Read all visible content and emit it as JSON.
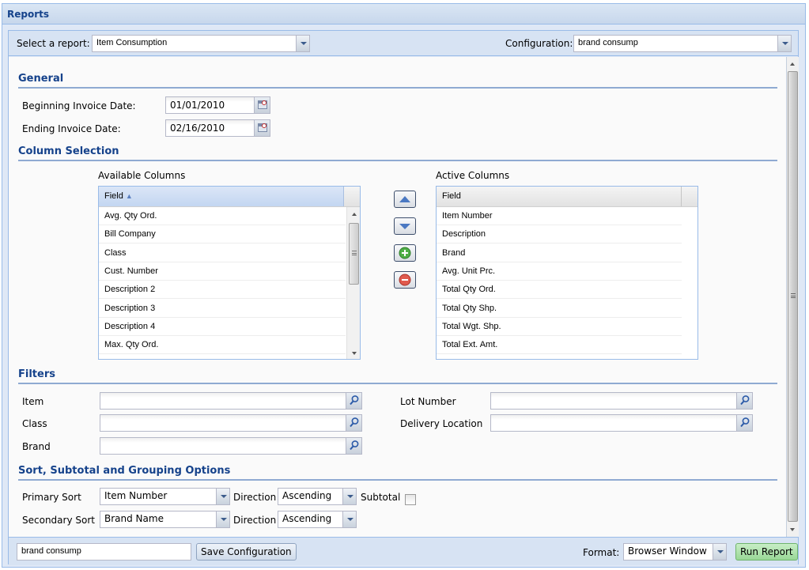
{
  "window": {
    "title": "Reports"
  },
  "topbar": {
    "report_label": "Select a report:",
    "report_value": "Item Consumption",
    "config_label": "Configuration:",
    "config_value": "brand consump"
  },
  "general": {
    "title": "General",
    "begin_label": "Beginning Invoice Date:",
    "begin_value": "01/01/2010",
    "end_label": "Ending Invoice Date:",
    "end_value": "02/16/2010"
  },
  "columns": {
    "title": "Column Selection",
    "available_title": "Available Columns",
    "available_header": "Field",
    "available": [
      "Avg. Qty Ord.",
      "Bill Company",
      "Class",
      "Cust. Number",
      "Description 2",
      "Description 3",
      "Description 4",
      "Max. Qty Ord."
    ],
    "active_title": "Active Columns",
    "active_header": "Field",
    "active": [
      "Item Number",
      "Description",
      "Brand",
      "Avg. Unit Prc.",
      "Total Qty Ord.",
      "Total Qty Shp.",
      "Total Wgt. Shp.",
      "Total Ext. Amt."
    ],
    "buttons": [
      "move-up",
      "move-down",
      "add",
      "remove"
    ]
  },
  "filters": {
    "title": "Filters",
    "left": [
      {
        "label": "Item",
        "value": ""
      },
      {
        "label": "Class",
        "value": ""
      },
      {
        "label": "Brand",
        "value": ""
      }
    ],
    "right": [
      {
        "label": "Lot Number",
        "value": ""
      },
      {
        "label": "Delivery Location",
        "value": ""
      }
    ]
  },
  "sort": {
    "title": "Sort, Subtotal and Grouping Options",
    "primary_label": "Primary Sort",
    "primary_value": "Item Number",
    "secondary_label": "Secondary Sort",
    "secondary_value": "Brand Name",
    "direction_label": "Direction",
    "primary_direction": "Ascending",
    "secondary_direction": "Ascending",
    "subtotal_label": "Subtotal",
    "subtotal_checked": false
  },
  "footer": {
    "config_name": "brand consump",
    "save_label": "Save Configuration",
    "format_label": "Format:",
    "format_value": "Browser Window",
    "run_label": "Run Report"
  },
  "colors": {
    "accent": "#15428b",
    "panel_bg": "#dfe8f6",
    "border": "#99bbe8",
    "run_button": "#98d796"
  }
}
